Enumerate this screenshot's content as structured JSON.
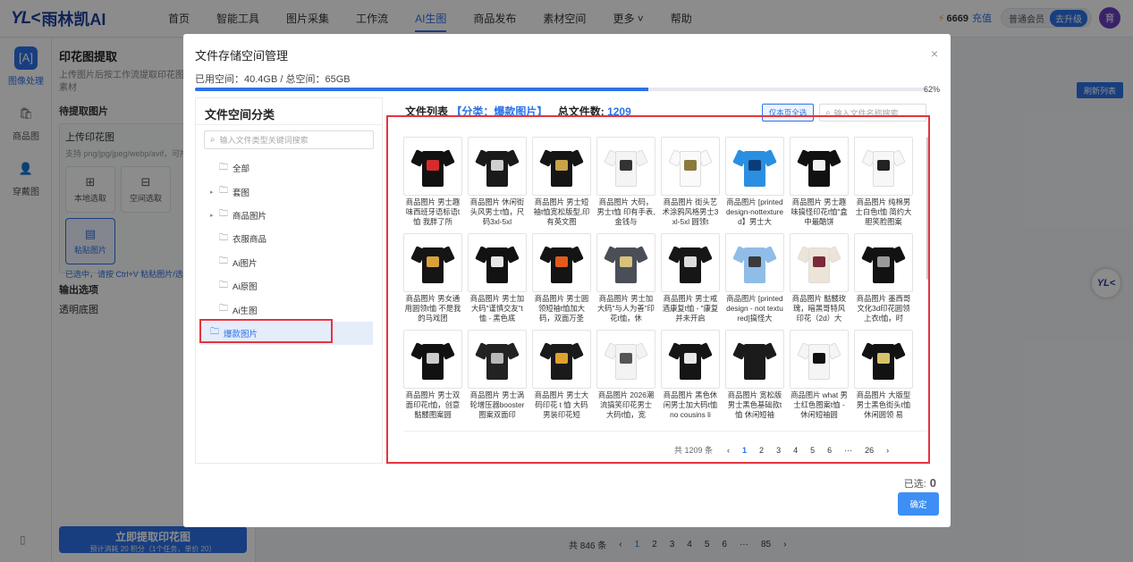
{
  "nav": {
    "logo_mark": "YL<",
    "logo_text": "雨林凯AI",
    "items": [
      "首页",
      "智能工具",
      "图片采集",
      "工作流",
      "AI生图",
      "商品发布",
      "素材空间",
      "更多 ˅",
      "帮助"
    ],
    "active_index": 4,
    "credits": "6669",
    "recharge": "充值",
    "member": "普通会员",
    "upgrade": "去升级",
    "avatar": "育"
  },
  "rail": {
    "items": [
      {
        "label": "图像处理",
        "icon": "image-process-icon",
        "glyph": "[A]"
      },
      {
        "label": "商品图",
        "icon": "product-bag-icon",
        "glyph": "🛍"
      },
      {
        "label": "穿戴图",
        "icon": "person-icon",
        "glyph": "👤"
      }
    ],
    "bottom_glyph": "▯"
  },
  "panel": {
    "title": "印花图提取",
    "desc": "上传图片后按工作流提取印花图案，产出的印花素材",
    "section_input": "待提取图片",
    "upload_title": "上传印花图",
    "upload_sub": "支持 png/jpg/jpeg/webp/avif，可拖拽",
    "btn_local": "本地选取",
    "btn_space": "空间选取",
    "btn_paste": "粘贴图片",
    "hint": "已选中，请按 Ctrl+V 粘贴图片/选择素",
    "section_output": "输出选项",
    "opt_transparent": "透明底图",
    "cta": "立即提取印花图",
    "cta_sub": "预计消耗 20 积分（1个任务，单价 20）"
  },
  "background": {
    "refresh_label": "刷新列表",
    "pager": {
      "total": "共 846 条",
      "pages": [
        "1",
        "2",
        "3",
        "4",
        "5",
        "6",
        "···",
        "85"
      ],
      "current": "1"
    }
  },
  "modal": {
    "title": "文件存储空间管理",
    "usage": "已用空间：40.4GB / 总空间：65GB",
    "usage_fraction": 0.62,
    "usage_pct": "62%",
    "categories_title": "文件空间分类",
    "category_search_placeholder": "输入文件类型关键词搜索",
    "categories": [
      {
        "label": "全部",
        "expandable": false
      },
      {
        "label": "套图",
        "expandable": true
      },
      {
        "label": "商品图片",
        "expandable": true
      },
      {
        "label": "衣服商品",
        "expandable": false
      },
      {
        "label": "Ai图片",
        "expandable": false
      },
      {
        "label": "Ai原图",
        "expandable": false
      },
      {
        "label": "Ai生图",
        "expandable": false
      },
      {
        "label": "爆款图片",
        "expandable": false,
        "active": true
      }
    ],
    "file_list_label": "文件列表",
    "file_category": "【分类：爆款图片】",
    "total_label": "总文件数:",
    "total_value": "1209",
    "select_page_all": "仅本页全选",
    "file_search_placeholder": "输入文件名称搜索",
    "files": [
      {
        "caption": "商品图片 男士趣味西班牙语标语t恤 我胖了所",
        "body": "#111111",
        "print": "#d42b2b"
      },
      {
        "caption": "商品图片 休闲街头风男士t恤，尺码3xl-5xl",
        "body": "#1a1a1a",
        "print": "#cfcfcf"
      },
      {
        "caption": "商品图片 男士短袖t恤宽松版型,印有英文图",
        "body": "#151515",
        "print": "#c9a24a"
      },
      {
        "caption": "商品图片 大码，男士t恤 印有手表,金钱与",
        "body": "#f4f4f4",
        "print": "#333333"
      },
      {
        "caption": "商品图片 街头艺术涂鸦风格男士3xl-5xl 圆领t",
        "body": "#fafafa",
        "print": "#8a7b3c"
      },
      {
        "caption": "商品图片 [printed design-nottextured】男士大",
        "body": "#2a8fe0",
        "print": "#0c3b7a"
      },
      {
        "caption": "商品图片 男士趣味搞怪印花t恤\"盒中最酷饼",
        "body": "#111111",
        "print": "#f2f2f2"
      },
      {
        "caption": "商品图片 纯棉男士白色t恤 简约大胆笑脸图案",
        "body": "#f7f7f7",
        "print": "#222222"
      },
      {
        "caption": "商品图片 男女通用圆领t恤 不是我的马戏团",
        "body": "#151515",
        "print": "#d9a13a"
      },
      {
        "caption": "商品图片 男士加大码\"谨慎交友\"t恤 - 黑色底",
        "body": "#121212",
        "print": "#e6e6e6"
      },
      {
        "caption": "商品图片 男士圆领短袖t恤加大码，双面万圣",
        "body": "#141414",
        "print": "#e25a1c"
      },
      {
        "caption": "商品图片 男士加大码\"与人为善\"印花t恤，休",
        "body": "#4a4f57",
        "print": "#d9c27a"
      },
      {
        "caption": "商品图片 男士戒酒康复t恤 - \"康复并未开启",
        "body": "#161616",
        "print": "#dcdcdc"
      },
      {
        "caption": "商品图片 [printed design - not textured]搞怪大",
        "body": "#8fbde8",
        "print": "#3b3b3b"
      },
      {
        "caption": "商品图片 骷髅玫瑰，暗黑哥特风印花（2d）大",
        "body": "#ece4d6",
        "print": "#7a2a3a"
      },
      {
        "caption": "商品图片 墨西哥文化3d印花圆领上衣t恤，时",
        "body": "#121212",
        "print": "#9a9a9a"
      },
      {
        "caption": "商品图片 男士双面印花t恤，创意骷髅图案圆",
        "body": "#111111",
        "print": "#cccccc"
      },
      {
        "caption": "商品图片 男士涡轮增压器booster图案双面印",
        "body": "#222222",
        "print": "#b8b8b8"
      },
      {
        "caption": "商品图片 男士大码印花 t 恤 大码男装印花短",
        "body": "#1a1a1a",
        "print": "#e0a030"
      },
      {
        "caption": "商品图片 2026潮流搞笑印花男士大码t恤，宽",
        "body": "#f3f3f3",
        "print": "#555555"
      },
      {
        "caption": "商品图片 黑色休闲男士加大码t恤 no cousins li",
        "body": "#151515",
        "print": "#e8e8e8"
      },
      {
        "caption": "商品图片 宽松版男士黑色基础款t恤 休闲短袖",
        "body": "#1b1b1b",
        "print": "#1b1b1b"
      },
      {
        "caption": "商品图片 what 男士红色图案t恤 - 休闲短袖圆",
        "body": "#f5f5f5",
        "print": "#111111"
      },
      {
        "caption": "商品图片 大版型男士黑色街头t恤 休闲圆领 易",
        "body": "#121212",
        "print": "#d8c36a"
      }
    ],
    "pager": {
      "total": "共 1209 条",
      "prev": "‹",
      "next": "›",
      "pages": [
        "1",
        "2",
        "3",
        "4",
        "5",
        "6",
        "···",
        "26"
      ],
      "current": "1"
    },
    "selected_label": "已选:",
    "selected_count": "0",
    "confirm": "确定",
    "close_glyph": "×"
  },
  "float_logo": "YL<"
}
